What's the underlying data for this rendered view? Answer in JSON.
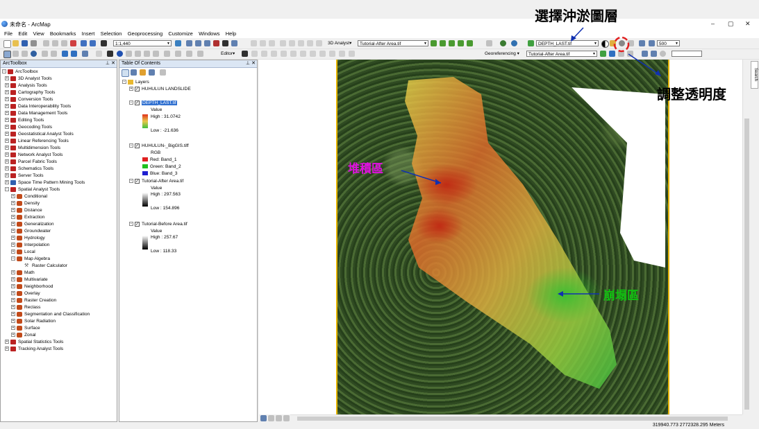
{
  "window": {
    "title": "未命名 - ArcMap",
    "min": "–",
    "max": "▢",
    "close": "✕"
  },
  "annotations": {
    "select_layer": "選擇沖淤圖層",
    "adjust_transparency": "調整透明度",
    "deposition": "堆積區",
    "collapse": "崩塌區"
  },
  "menu": [
    "File",
    "Edit",
    "View",
    "Bookmarks",
    "Insert",
    "Selection",
    "Geoprocessing",
    "Customize",
    "Windows",
    "Help"
  ],
  "toolbar": {
    "scale": "1:1,440",
    "analyst_3d": "3D Analyst▾",
    "analyst_layer": "Tutorial-After Area.tif",
    "effects_layer": "DEPTH_LAST.tif",
    "zoom_value": "500",
    "editor": "Editor▾",
    "georef": "Georeferencing ▾",
    "georef_layer": "Tutorial-After Area.tif"
  },
  "arctoolbox": {
    "header": "ArcToolbox",
    "root": "ArcToolbox",
    "toolboxes": [
      "3D Analyst Tools",
      "Analysis Tools",
      "Cartography Tools",
      "Conversion Tools",
      "Data Interoperability Tools",
      "Data Management Tools",
      "Editing Tools",
      "Geocoding Tools",
      "Geostatistical Analyst Tools",
      "Linear Referencing Tools",
      "Multidimension Tools",
      "Network Analyst Tools",
      "Parcel Fabric Tools",
      "Schematics Tools",
      "Server Tools",
      "Space Time Pattern Mining Tools",
      "Spatial Analyst Tools"
    ],
    "spatial_analyst_sets": [
      "Conditional",
      "Density",
      "Distance",
      "Extraction",
      "Generalization",
      "Groundwater",
      "Hydrology",
      "Interpolation",
      "Local",
      "Map Algebra"
    ],
    "map_algebra_tool": "Raster Calculator",
    "spatial_analyst_sets2": [
      "Math",
      "Multivariate",
      "Neighborhood",
      "Overlay",
      "Raster Creation",
      "Reclass",
      "Segmentation and Classification",
      "Solar Radiation",
      "Surface",
      "Zonal"
    ],
    "after": [
      "Spatial Statistics Tools",
      "Tracking Analyst Tools"
    ]
  },
  "toc": {
    "header": "Table Of Contents",
    "layers_root": "Layers",
    "layers": [
      {
        "name": "HUHULUN LANDSLIDE",
        "legend": []
      },
      {
        "name": "DEPTH_LAST.tif",
        "legend": [
          "Value",
          "High : 31.0742",
          "Low : -21.636"
        ]
      },
      {
        "name": "HUHULUN-_BigGIS.tiff",
        "legend": [
          "RGB",
          "Red:   Band_1",
          "Green: Band_2",
          "Blue:  Band_3"
        ]
      },
      {
        "name": "Tutorial-After Area.tif",
        "legend": [
          "Value",
          "High : 297.563",
          "Low : 154.896"
        ]
      },
      {
        "name": "Tutorial-Before Area.tif",
        "legend": [
          "Value",
          "High : 257.67",
          "Low : 118.33"
        ]
      }
    ]
  },
  "status": {
    "coords": "319940.773  2772328.295 Meters"
  },
  "search_tab": "Search",
  "colors": {
    "depth_high": "#e0301a",
    "depth_mid": "#e8c84a",
    "depth_low": "#40c040",
    "highlight_red": "#e02020",
    "arrow_blue": "#1030b0",
    "deposition_text": "#e010e0",
    "collapse_text": "#10c010"
  }
}
